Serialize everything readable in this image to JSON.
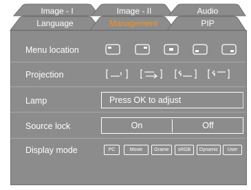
{
  "tabs_top": [
    "Image - I",
    "Image - II",
    "Audio"
  ],
  "tabs_bottom": [
    "Language",
    "Management",
    "PIP"
  ],
  "active_tab": "Management",
  "colors": {
    "panel": "#8c8c8c",
    "tab_fill": "#8c8c8c",
    "active_tab_text": "#f7931e",
    "text": "#ffffff"
  },
  "rows": {
    "menu_location": {
      "label": "Menu location",
      "icons": [
        "top-left-position-icon",
        "top-right-position-icon",
        "center-position-icon",
        "bottom-left-position-icon",
        "bottom-right-position-icon"
      ]
    },
    "projection": {
      "label": "Projection",
      "icons": [
        "front-desktop-projection-icon",
        "rear-desktop-projection-icon",
        "front-ceiling-projection-icon",
        "rear-ceiling-projection-icon"
      ]
    },
    "lamp": {
      "label": "Lamp",
      "value": "Press OK  to adjust"
    },
    "source_lock": {
      "label": "Source lock",
      "options": [
        "On",
        "Off"
      ]
    },
    "display_mode": {
      "label": "Display mode",
      "options": [
        "PC",
        "Movie",
        "Grame",
        "sRGB",
        "Dynamic",
        "User"
      ]
    }
  }
}
